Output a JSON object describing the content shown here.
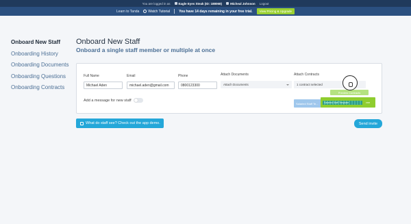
{
  "topbar": {
    "logged_in_as": "You are logged in as",
    "org": "Eagle Eyes Steak (ID: 188068)",
    "user": "Micheal Johnson",
    "logout": "Logout"
  },
  "trialbar": {
    "learn": "Learn to Tanda",
    "watch_tutorial": "Watch Tutorial",
    "trial_text": "You have 14 days remaining in your free trial.",
    "upgrade_label": "View Pricing & Upgrade"
  },
  "sidebar": {
    "items": [
      {
        "label": "Onboard New Staff",
        "active": true
      },
      {
        "label": "Onboarding History"
      },
      {
        "label": "Onboarding Documents"
      },
      {
        "label": "Onboarding Questions"
      },
      {
        "label": "Onboarding Contracts"
      }
    ]
  },
  "main": {
    "title": "Onboard New Staff",
    "subtitle": "Onboard a single staff member or multiple at once"
  },
  "form": {
    "full_name_label": "Full Name",
    "full_name_value": "Michael Aden",
    "email_label": "Email",
    "email_value": "michael.aden@gmail.com",
    "phone_label": "Phone",
    "phone_value": "0800123300",
    "attach_documents_label": "Attach Documents",
    "attach_documents_value": "Attach Documents",
    "attach_contracts_label": "Attach Contracts",
    "attach_contracts_value": "1 contract selected",
    "preview_contracts_label": "Preview Contracts",
    "salaried_staff_label": "Salaried Staff Te...",
    "salaried_overlay_label": "Salaried Staff Template",
    "salaried_button_word": "ree",
    "message_label": "Add a message for new staff",
    "message_toggle_on": false
  },
  "actions": {
    "demo_label": "What do staff see? Check out the app demo.",
    "send_label": "Send invite"
  },
  "colors": {
    "nav_dark": "#203a5c",
    "trial_bar": "#2b5080",
    "upgrade_green": "#9bd132",
    "primary_blue": "#24a7d9"
  }
}
